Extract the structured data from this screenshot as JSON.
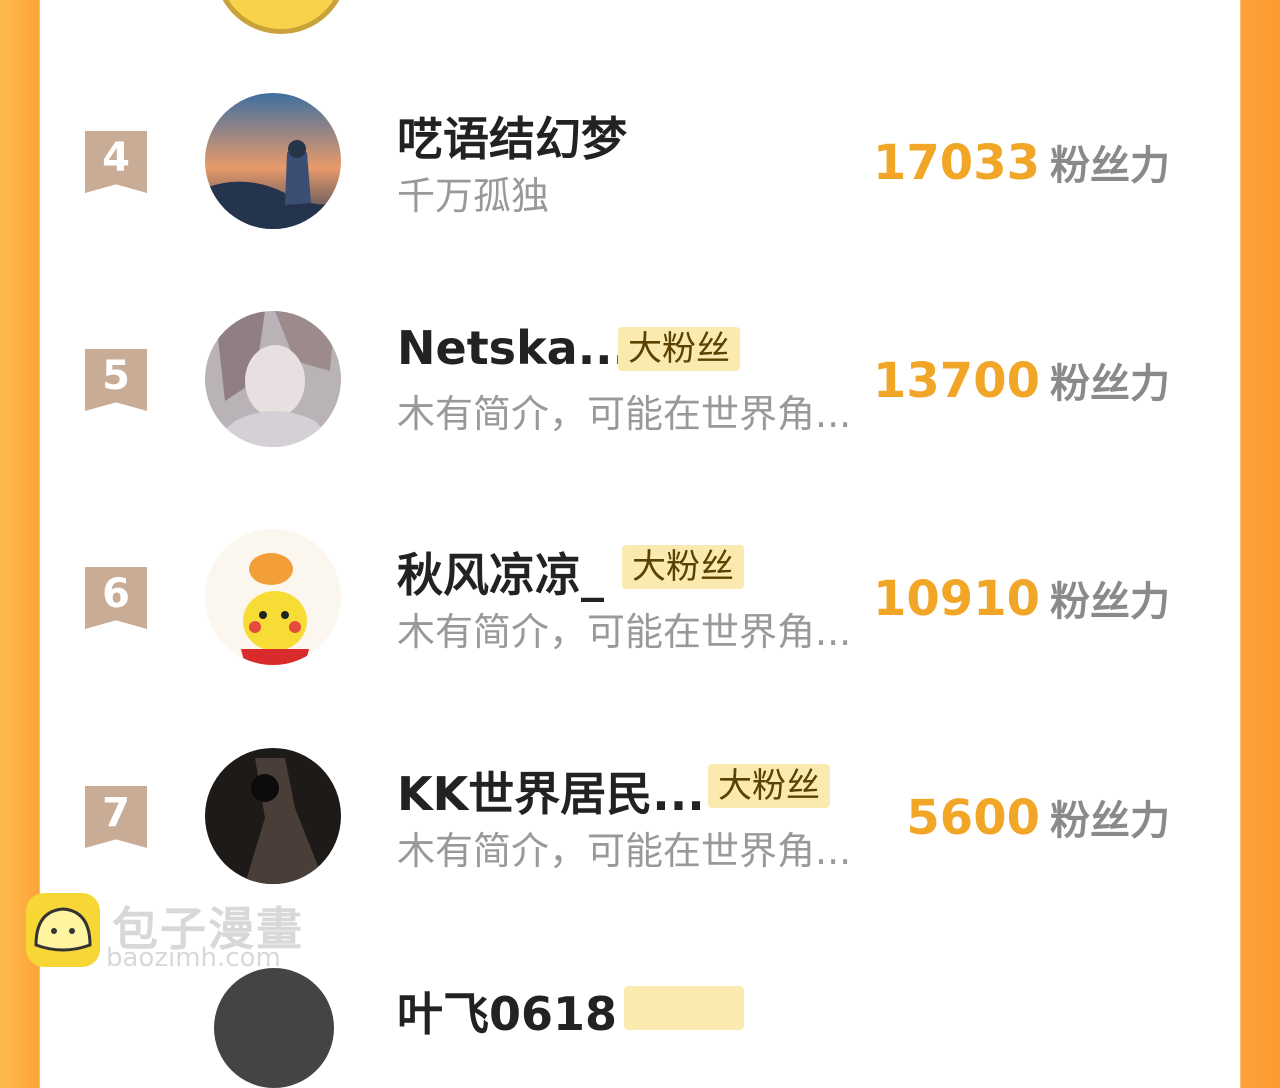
{
  "colors": {
    "accent": "#f2a628",
    "badge_bg": "#fbeab0",
    "rank_ribbon": "#c9ac96",
    "frame": "#fda33a"
  },
  "unit_label": "粉丝力",
  "rows": [
    {
      "rank": "4",
      "name": "呓语结幻梦",
      "badge": "",
      "bio": "千万孤独",
      "score": "17033"
    },
    {
      "rank": "5",
      "name": "Netska...",
      "badge": "大粉丝",
      "bio": "木有简介，可能在世界角...",
      "score": "13700"
    },
    {
      "rank": "6",
      "name": "秋风凉凉_",
      "badge": "大粉丝",
      "bio": "木有简介，可能在世界角...",
      "score": "10910"
    },
    {
      "rank": "7",
      "name": "KK世界居民...",
      "badge": "大粉丝",
      "bio": "木有简介，可能在世界角...",
      "score": "5600"
    }
  ],
  "partial_next": {
    "name": "叶飞0618"
  },
  "watermark": {
    "title": "包子漫畫",
    "url": "baozimh.com"
  }
}
